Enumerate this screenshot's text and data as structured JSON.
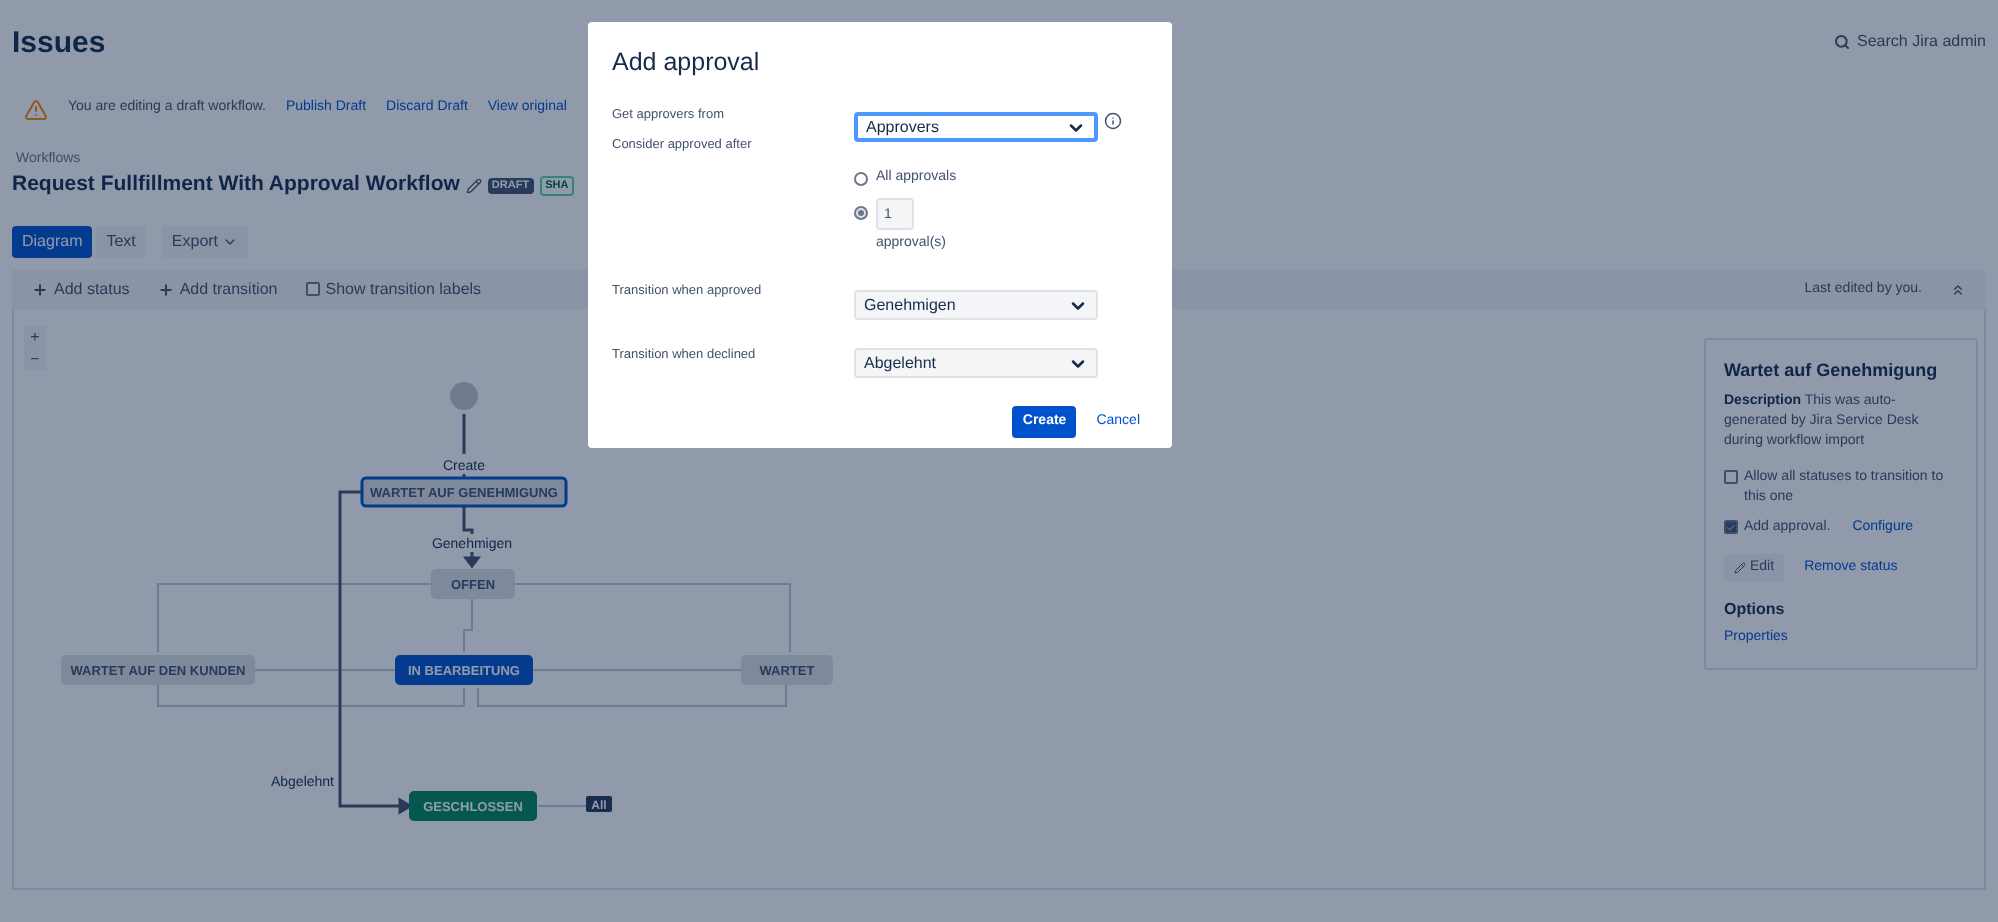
{
  "header": {
    "title": "Issues",
    "search": "Search Jira admin"
  },
  "draft_bar": {
    "message": "You are editing a draft workflow.",
    "links": [
      "Publish Draft",
      "Discard Draft",
      "View original"
    ]
  },
  "breadcrumb": "Workflows",
  "workflow": {
    "title": "Request Fullfillment With Approval Workflow",
    "badges": [
      {
        "label": "DRAFT",
        "kind": "draft"
      },
      {
        "label": "SHA",
        "kind": "shared"
      }
    ]
  },
  "view_tabs": [
    {
      "label": "Diagram",
      "selected": true
    },
    {
      "label": "Text",
      "selected": false
    }
  ],
  "export_button": "Export",
  "toolbar": {
    "add_status": "Add status",
    "add_transition": "Add transition",
    "show_labels": {
      "label": "Show transition labels",
      "checked": false
    },
    "last_edited": "Last edited by you."
  },
  "zoom": [
    "+",
    "−"
  ],
  "diagram": {
    "nodes": [
      {
        "label": "WARTET AUF GENEHMIGUNG",
        "kind": "selected"
      },
      {
        "label": "OFFEN",
        "kind": "normal"
      },
      {
        "label": "WARTET AUF DEN KUNDEN",
        "kind": "normal"
      },
      {
        "label": "IN BEARBEITUNG",
        "kind": "in_progress"
      },
      {
        "label": "WARTET",
        "kind": "normal"
      },
      {
        "label": "GESCHLOSSEN",
        "kind": "done"
      }
    ],
    "transition_labels": [
      "Create",
      "Genehmigen",
      "Abgelehnt"
    ],
    "all_badge": "All"
  },
  "status_panel": {
    "title": "Wartet auf Genehmigung",
    "description_label": "Description",
    "description": "This was auto-generated by Jira Service Desk during workflow import",
    "options": [
      {
        "label": "Allow all statuses to transition to this one",
        "checked": false
      },
      {
        "label": "Add approval.",
        "checked": true,
        "link": "Configure"
      }
    ],
    "edit_button": "Edit",
    "remove_link": "Remove status",
    "options_title": "Options",
    "properties_link": "Properties"
  },
  "dialog": {
    "title": "Add approval",
    "approvers_label": "Get approvers from",
    "approvers_value": "Approvers",
    "consider_label": "Consider approved after",
    "radios": [
      {
        "label": "All approvals",
        "selected": false
      },
      {
        "label": "approval(s)",
        "selected": true,
        "value": "1"
      }
    ],
    "approved_label": "Transition when approved",
    "approved_value": "Genehmigen",
    "declined_label": "Transition when declined",
    "declined_value": "Abgelehnt",
    "create": "Create",
    "cancel": "Cancel"
  }
}
